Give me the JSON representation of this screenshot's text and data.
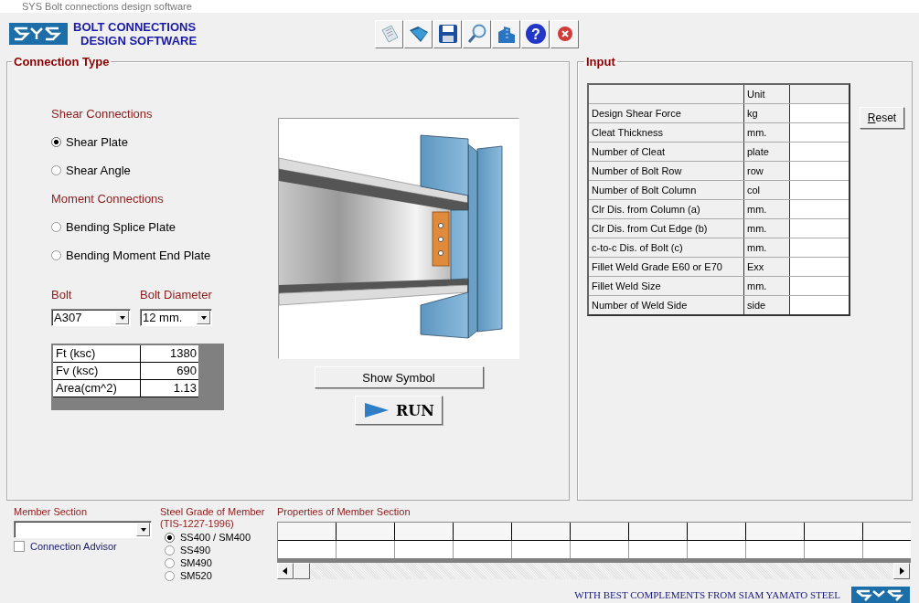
{
  "window": {
    "title": "SYS Bolt connections design software"
  },
  "header": {
    "title_lines": [
      "BOLT CONNECTIONS",
      "DESIGN SOFTWARE"
    ],
    "help_glyph": "?"
  },
  "connection_type": {
    "title": "Connection Type",
    "groups": [
      {
        "heading": "Shear Connections",
        "options": [
          {
            "label": "Shear Plate",
            "selected": true
          },
          {
            "label": "Shear Angle",
            "selected": false
          }
        ]
      },
      {
        "heading": "Moment Connections",
        "options": [
          {
            "label": "Bending Splice Plate",
            "selected": false
          },
          {
            "label": "Bending Moment End Plate",
            "selected": false
          }
        ]
      }
    ],
    "bolt": {
      "label": "Bolt",
      "value": "A307"
    },
    "bolt_diameter": {
      "label": "Bolt Diameter",
      "value": "12 mm."
    },
    "bolt_properties": [
      {
        "name": "Ft (ksc)",
        "value": "1380"
      },
      {
        "name": "Fv (ksc)",
        "value": "690"
      },
      {
        "name": "Area(cm^2)",
        "value": "1.13"
      }
    ],
    "show_symbol": "Show Symbol",
    "run": "RUN"
  },
  "input": {
    "title": "Input",
    "unit_heading": "Unit",
    "reset": "Reset",
    "rows": [
      {
        "label": "Design Shear Force",
        "unit": "kg"
      },
      {
        "label": "Cleat Thickness",
        "unit": "mm."
      },
      {
        "label": "Number of Cleat",
        "unit": "plate"
      },
      {
        "label": "Number of Bolt Row",
        "unit": "row"
      },
      {
        "label": "Number of Bolt Column",
        "unit": "col"
      },
      {
        "label": "Clr Dis. from Column (a)",
        "unit": "mm."
      },
      {
        "label": "Clr Dis. from Cut Edge (b)",
        "unit": "mm."
      },
      {
        "label": "c-to-c Dis. of Bolt (c)",
        "unit": "mm."
      },
      {
        "label": "Fillet Weld Grade E60 or E70",
        "unit": "Exx"
      },
      {
        "label": "Fillet Weld Size",
        "unit": "mm."
      },
      {
        "label": "Number of Weld Side",
        "unit": "side"
      }
    ]
  },
  "member_section": {
    "label": "Member Section",
    "connection_advisor": {
      "label": "Connection Advisor",
      "checked": false
    }
  },
  "steel_grade": {
    "label_lines": [
      "Steel Grade of Member",
      "(TIS-1227-1996)"
    ],
    "options": [
      {
        "label": "SS400 / SM400",
        "selected": true
      },
      {
        "label": "SS490",
        "selected": false
      },
      {
        "label": "SM490",
        "selected": false
      },
      {
        "label": "SM520",
        "selected": false
      }
    ]
  },
  "properties": {
    "label": "Properties of Member Section"
  },
  "footer": "WITH BEST COMPLEMENTS FROM SIAM YAMATO STEEL"
}
